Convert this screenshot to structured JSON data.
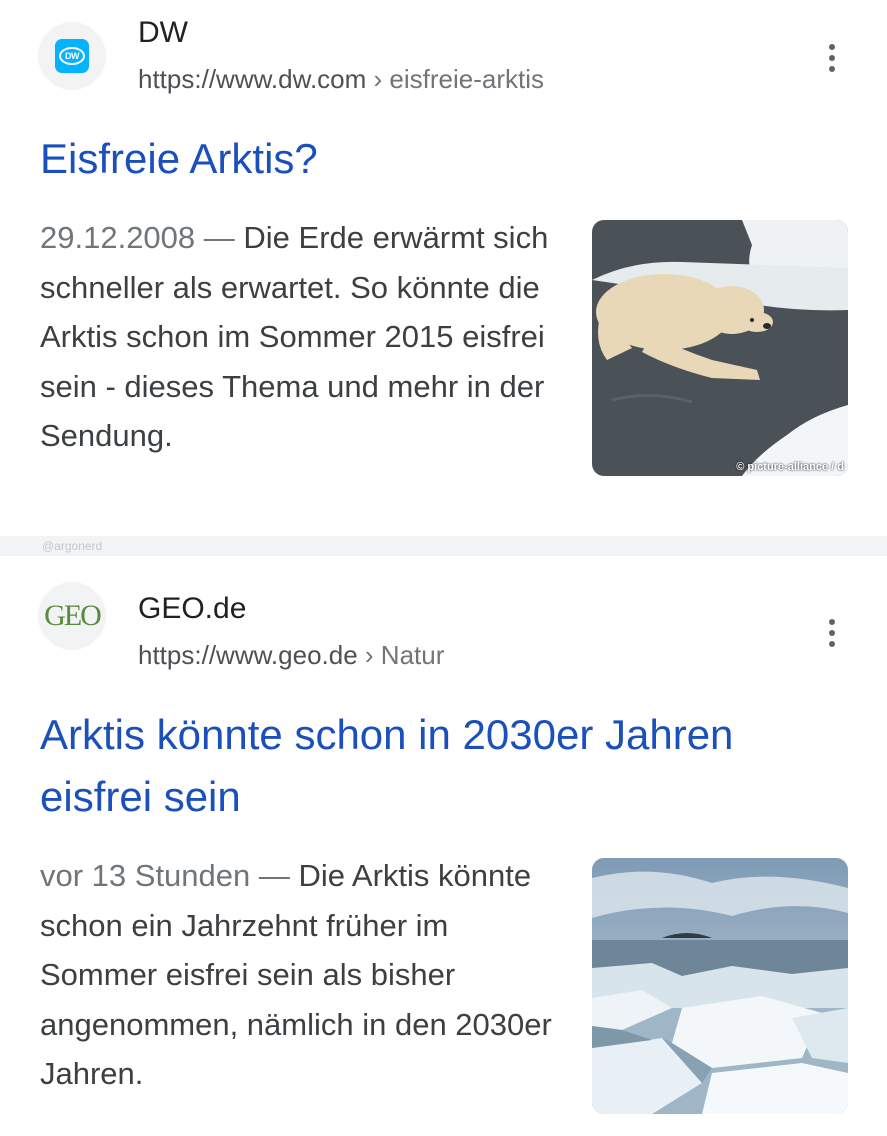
{
  "results": [
    {
      "site_name": "DW",
      "url_domain": "https://www.dw.com",
      "url_path": " › eisfreie-arktis",
      "title": "Eisfreie Arktis?",
      "date": "29.12.2008 — ",
      "snippet": "Die Erde erwärmt sich schneller als erwartet. So könnte die Arktis schon im Sommer 2015 eisfrei sein - dieses Thema und mehr in der Sendung.",
      "image_credit": "© picture-alliance / d",
      "favicon_icon": "dw-logo-icon"
    },
    {
      "site_name": "GEO.de",
      "url_domain": "https://www.geo.de",
      "url_path": " › Natur",
      "title": "Arktis könnte schon in 2030er Jahren eisfrei sein",
      "date": "vor 13 Stunden — ",
      "snippet": "Die Arktis könnte schon ein Jahrzehnt früher im Sommer eisfrei sein als bisher angenommen, nämlich in den 2030er Jahren.",
      "favicon_text": "GEO",
      "favicon_icon": "geo-logo-icon"
    }
  ],
  "watermark": "@argonerd",
  "colors": {
    "title_link": "#1a4fbc",
    "dw_brand": "#05b2fc",
    "geo_brand": "#5a8a3e"
  }
}
